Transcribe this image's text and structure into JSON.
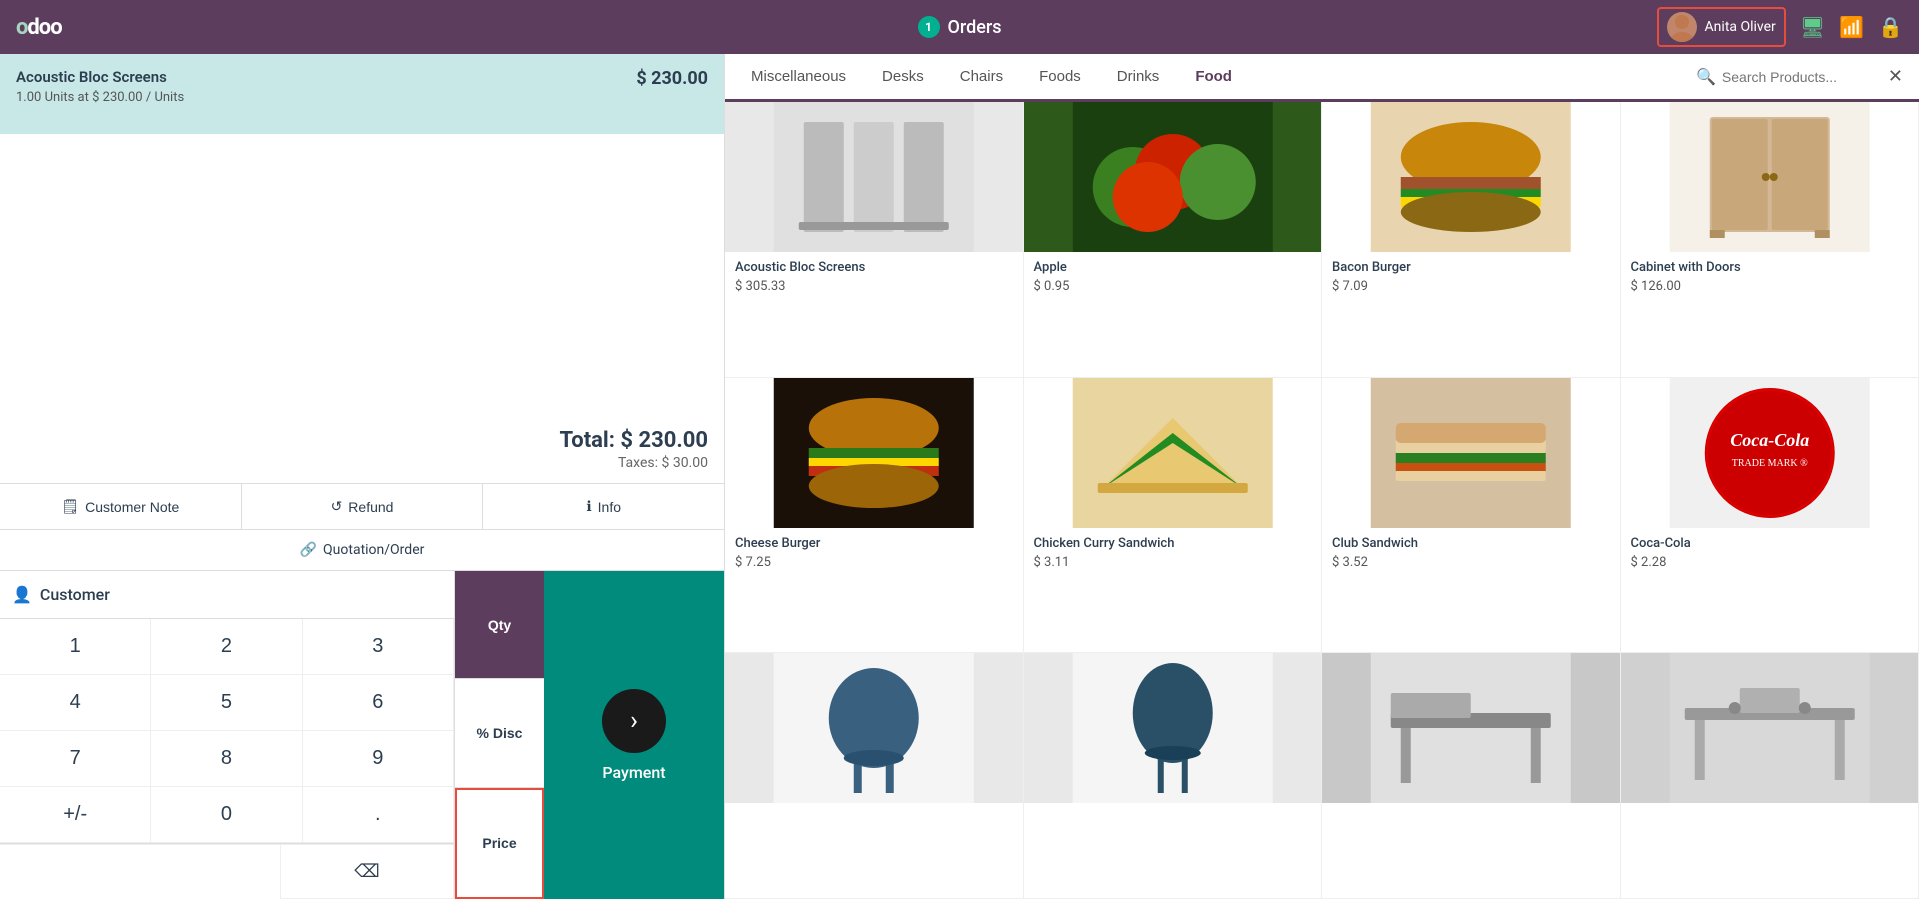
{
  "topnav": {
    "logo": "odoo",
    "orders_label": "Orders",
    "orders_badge": "1",
    "user_name": "Anita Oliver",
    "icons": [
      "monitor-icon",
      "wifi-icon",
      "lock-icon"
    ]
  },
  "order": {
    "item_name": "Acoustic Bloc Screens",
    "item_qty": "1.00",
    "item_unit": "Units",
    "item_unit_price": "230.00",
    "item_price": "$ 230.00",
    "total_label": "Total:",
    "total_value": "$ 230.00",
    "taxes_label": "Taxes:",
    "taxes_value": "$ 30.00"
  },
  "actions": {
    "customer_note_label": "Customer Note",
    "refund_label": "Refund",
    "info_label": "Info",
    "quotation_label": "Quotation/Order"
  },
  "numpad": {
    "customer_label": "Customer",
    "keys": [
      "1",
      "2",
      "3",
      "4",
      "5",
      "6",
      "7",
      "8",
      "9",
      "+/-",
      "0",
      "."
    ],
    "backspace_icon": "⌫",
    "qty_label": "Qty",
    "disc_label": "% Disc",
    "price_label": "Price"
  },
  "payment": {
    "label": "Payment",
    "arrow": "›"
  },
  "categories": {
    "tabs": [
      "Miscellaneous",
      "Desks",
      "Chairs",
      "Foods",
      "Drinks",
      "Food"
    ],
    "search_placeholder": "Search Products...",
    "active": "Food"
  },
  "products": [
    {
      "name": "Acoustic Bloc Screens",
      "price": "$ 305.33",
      "img_type": "acoustic"
    },
    {
      "name": "Apple",
      "price": "$ 0.95",
      "img_type": "apple"
    },
    {
      "name": "Bacon Burger",
      "price": "$ 7.09",
      "img_type": "baconburger"
    },
    {
      "name": "Cabinet with Doors",
      "price": "$ 126.00",
      "img_type": "cabinet"
    },
    {
      "name": "Cheese Burger",
      "price": "$ 7.25",
      "img_type": "cheeseburger"
    },
    {
      "name": "Chicken Curry Sandwich",
      "price": "$ 3.11",
      "img_type": "chicken"
    },
    {
      "name": "Club Sandwich",
      "price": "$ 3.52",
      "img_type": "club"
    },
    {
      "name": "Coca-Cola",
      "price": "$ 2.28",
      "img_type": "cola"
    },
    {
      "name": "",
      "price": "",
      "img_type": "chair1"
    },
    {
      "name": "",
      "price": "",
      "img_type": "chair2"
    },
    {
      "name": "",
      "price": "",
      "img_type": "desk1"
    },
    {
      "name": "",
      "price": "",
      "img_type": "desk2"
    }
  ]
}
